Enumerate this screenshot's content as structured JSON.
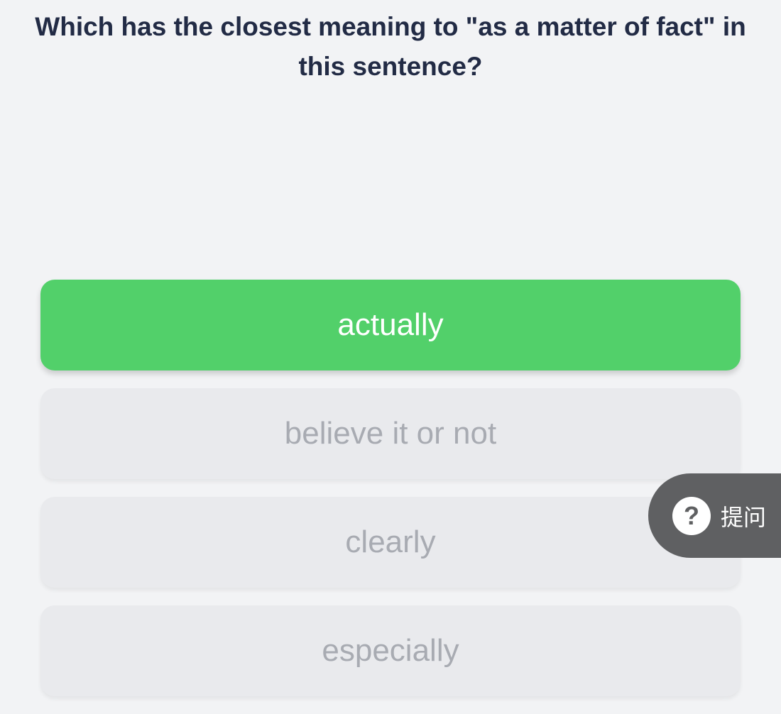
{
  "question": {
    "text": "Which has the closest meaning to \"as a matter of fact\" in this sentence?"
  },
  "options": [
    {
      "label": "actually",
      "state": "selected"
    },
    {
      "label": "believe it or not",
      "state": "unselected"
    },
    {
      "label": "clearly",
      "state": "unselected"
    },
    {
      "label": "especially",
      "state": "unselected"
    }
  ],
  "ask_button": {
    "icon_symbol": "?",
    "icon": "question-circle-icon",
    "label": "提问"
  },
  "colors": {
    "background": "#f2f3f5",
    "question_text": "#222b45",
    "selected_option": "#52d06a",
    "unselected_option": "#e9eaed",
    "unselected_text": "#a8abb2",
    "ask_button": "#5f6062"
  }
}
